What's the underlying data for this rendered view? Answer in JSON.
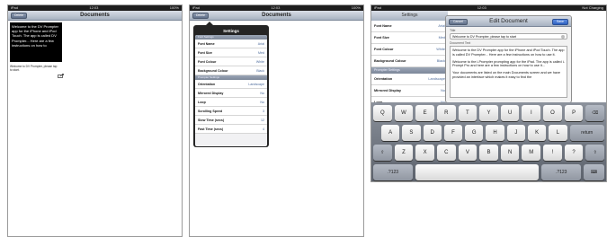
{
  "screen1": {
    "status_left": "iPad",
    "status_center": "12:03",
    "status_right": "100%",
    "nav_button": "Delete",
    "nav_title": "Documents",
    "document_text": "Welcome to the DV Prompter app for the iPhone and iPod Touch. The app is called DV Prompter... Here are a few instructions on how to",
    "small_text": "Welcome to DV Prompter, please tap to start."
  },
  "screen2": {
    "status_left": "iPad",
    "status_center": "12:03",
    "status_right": "100%",
    "nav_button": "Delete",
    "nav_title": "Documents",
    "popover_title": "Settings",
    "sections": [
      {
        "header": "Font Settings",
        "rows": [
          {
            "label": "Font Name",
            "value": "Arial"
          },
          {
            "label": "Font Size",
            "value": "Med"
          },
          {
            "label": "Font Colour",
            "value": "White"
          },
          {
            "label": "Background Colour",
            "value": "Black"
          }
        ]
      },
      {
        "header": "Prompter Settings",
        "rows": [
          {
            "label": "Orientation",
            "value": "Landscape"
          },
          {
            "label": "Mirrored Display",
            "value": "No"
          },
          {
            "label": "Loop",
            "value": "No"
          },
          {
            "label": "Scrolling Speed",
            "value": "3"
          },
          {
            "label": "Slow Time (secs)",
            "value": "12"
          },
          {
            "label": "Fast Time (secs)",
            "value": "4"
          }
        ]
      }
    ]
  },
  "screen3": {
    "status_left": "iPad",
    "status_center": "12:03",
    "status_right": "Not Charging",
    "bg_title": "Settings",
    "bg_rows_top": [
      {
        "label": "Font Name",
        "value": "Arial"
      },
      {
        "label": "Font Size",
        "value": "Med"
      },
      {
        "label": "Font Colour",
        "value": "White"
      },
      {
        "label": "Background Colour",
        "value": "Black"
      }
    ],
    "bg_section2": "Prompter Settings",
    "bg_rows_bottom": [
      {
        "label": "Orientation",
        "value": "Landscape"
      },
      {
        "label": "Mirrored Display",
        "value": "No"
      },
      {
        "label": "Loop",
        "value": "No"
      }
    ],
    "modal": {
      "cancel": "Cancel",
      "title": "Edit Document",
      "save": "Save",
      "title_label": "Title",
      "title_value": "Welcome to DV Prompter, please tap to start",
      "text_label": "Document Text",
      "paragraphs": [
        "Welcome to the DV Prompter app for the iPhone and iPod Touch. The app is called DV Prompter... Here are a few instructions on how to use it.",
        "Welcome to the i-Prompter prompting app for the iPad. The app is called i-Prompt Pro and here are a few instructions on how to use it...",
        "Your documents are listed on the main Documents screen and we have provided an interface which makes it easy to find the"
      ]
    },
    "keyboard": {
      "row1": [
        "Q",
        "W",
        "E",
        "R",
        "T",
        "Y",
        "U",
        "I",
        "O",
        "P",
        "⌫"
      ],
      "row2": [
        "A",
        "S",
        "D",
        "F",
        "G",
        "H",
        "J",
        "K",
        "L",
        "return"
      ],
      "row3": [
        "⇧",
        "Z",
        "X",
        "C",
        "V",
        "B",
        "N",
        "M",
        "!",
        "?",
        "⇧"
      ],
      "row4_left": ".?123",
      "row4_right": ".?123",
      "hide_key": "⌨"
    }
  }
}
